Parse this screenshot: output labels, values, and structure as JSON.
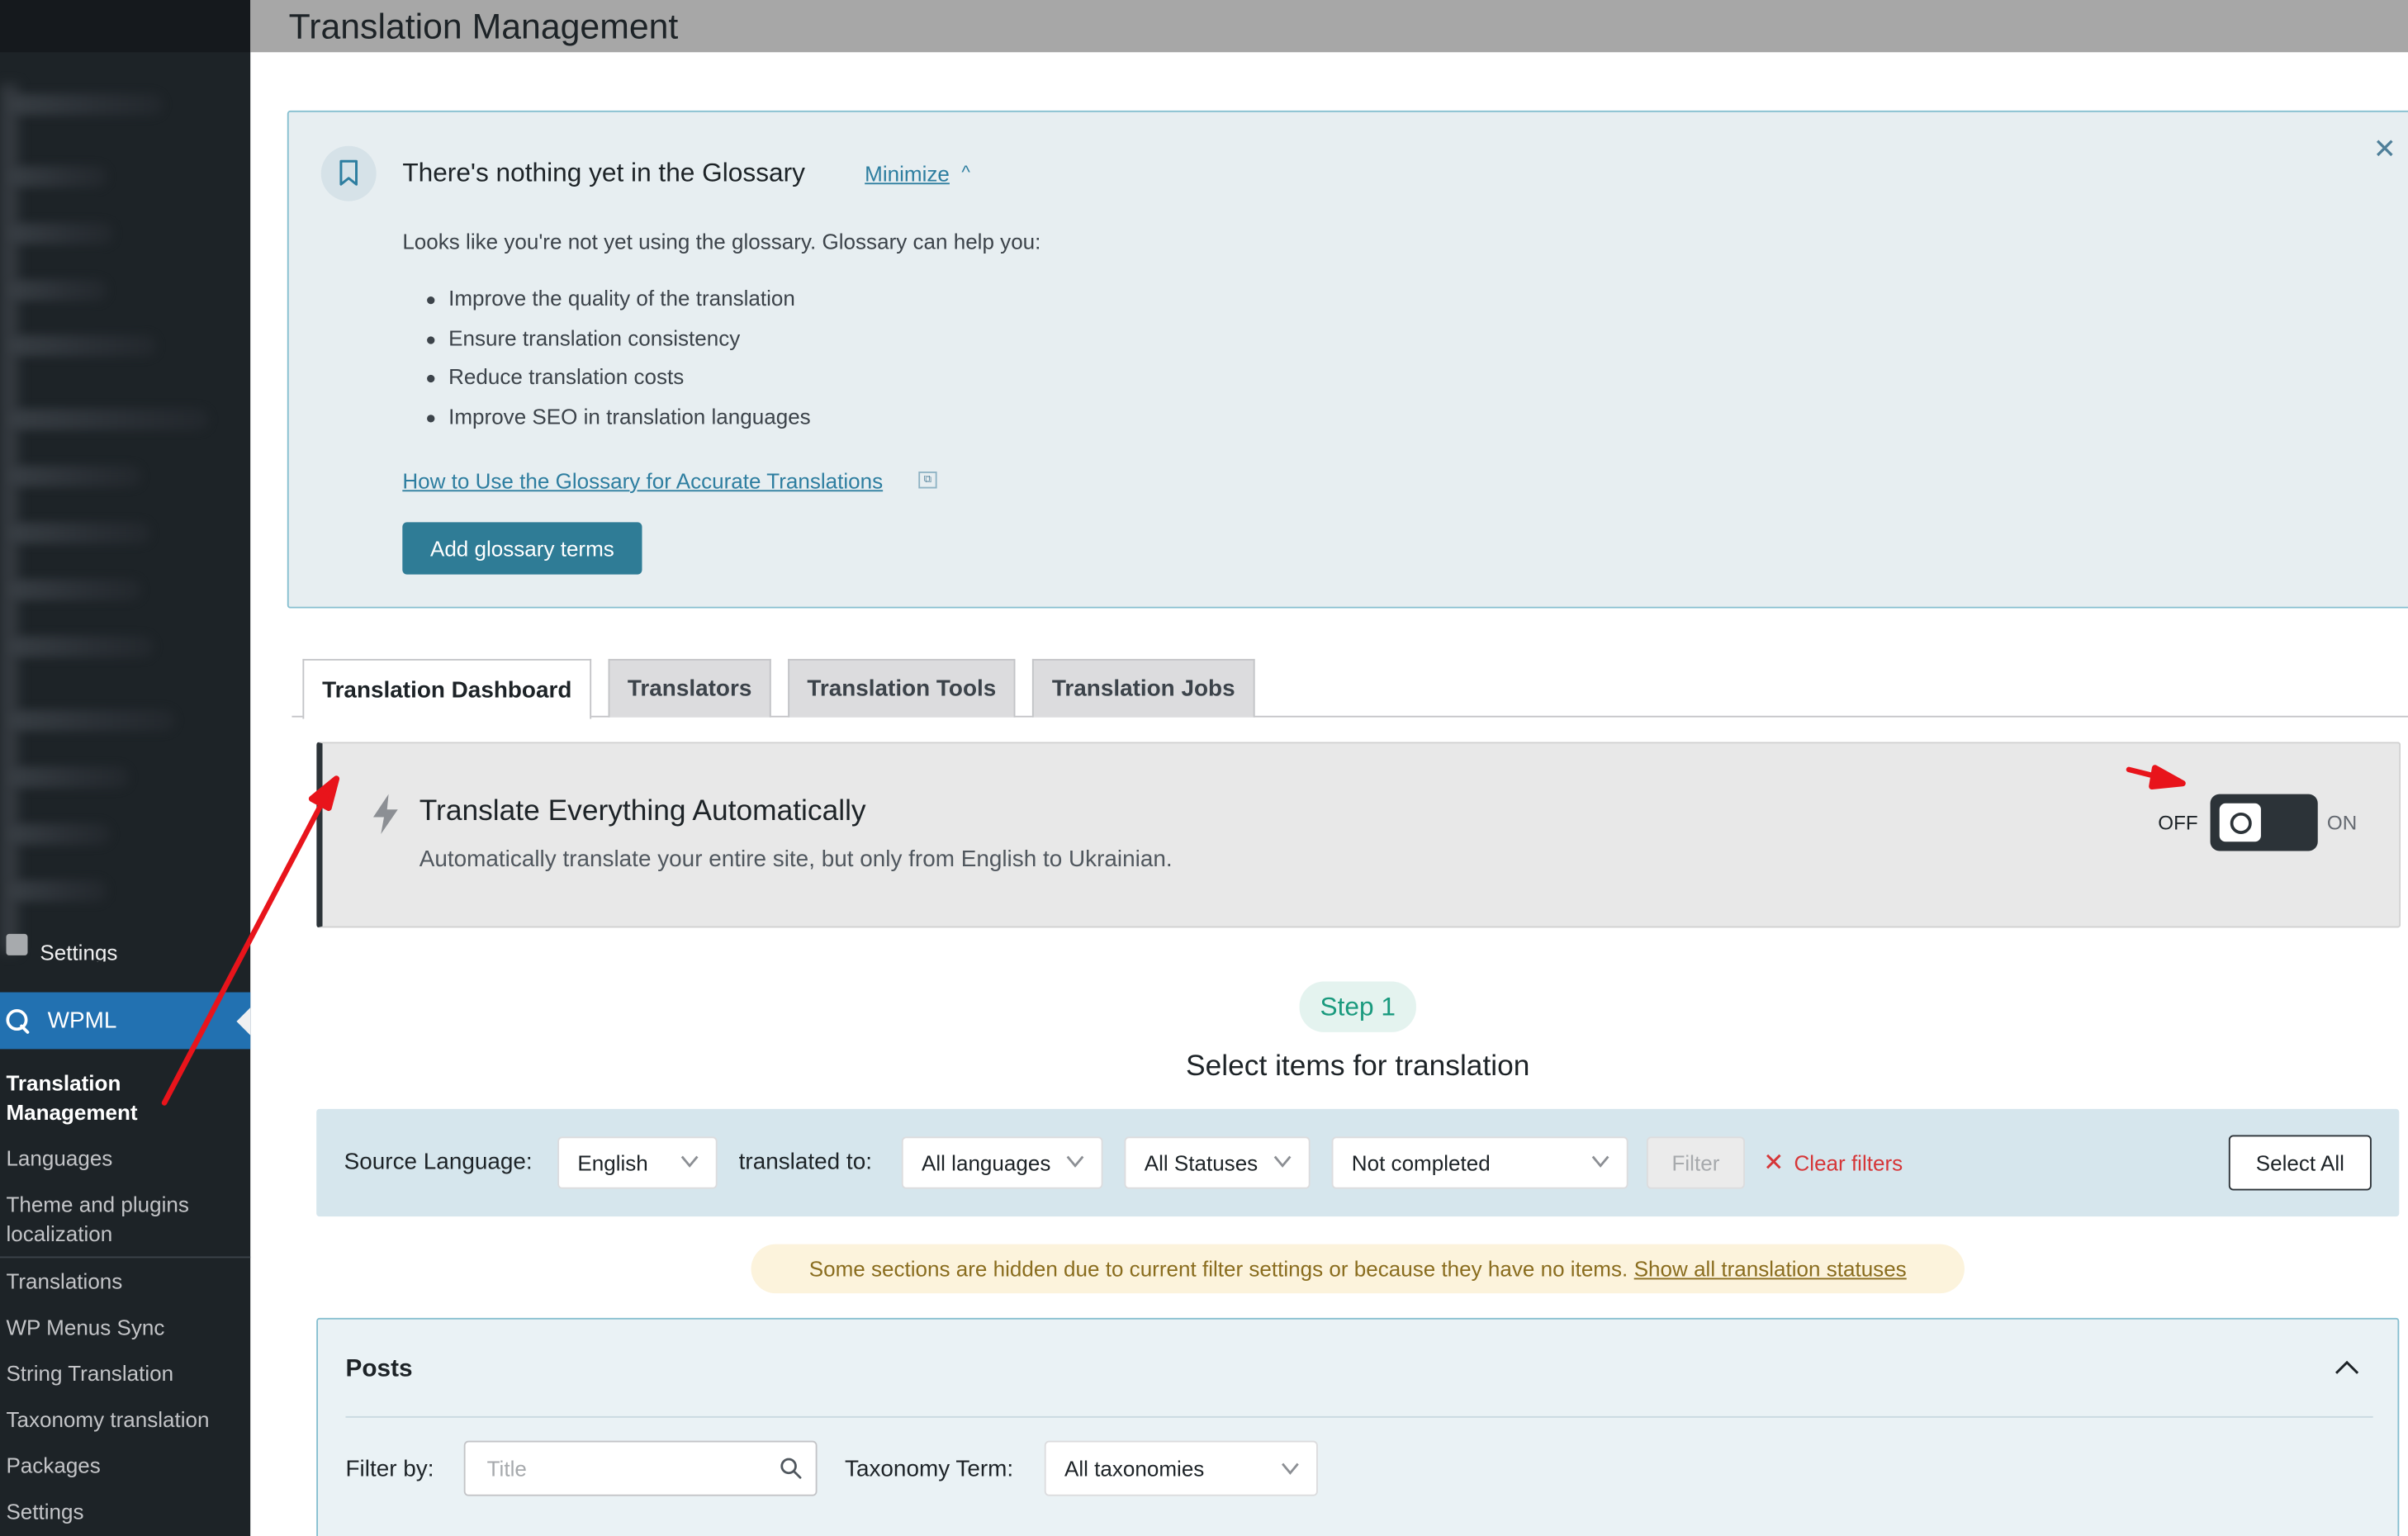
{
  "page": {
    "title": "Translation Management"
  },
  "sidebar": {
    "partial_item_label": "Settings",
    "active_menu": "WPML",
    "submenu": [
      {
        "label": "Translation Management",
        "current": true
      },
      {
        "label": "Languages"
      },
      {
        "label": "Theme and plugins localization"
      },
      {
        "label": "Translations"
      },
      {
        "label": "WP Menus Sync"
      },
      {
        "label": "String Translation"
      },
      {
        "label": "Taxonomy translation"
      },
      {
        "label": "Packages"
      },
      {
        "label": "Settings"
      }
    ]
  },
  "glossary": {
    "title": "There's nothing yet in the Glossary",
    "minimize_label": "Minimize",
    "description": "Looks like you're not yet using the glossary. Glossary can help you:",
    "benefits": [
      "Improve the quality of the translation",
      "Ensure translation consistency",
      "Reduce translation costs",
      "Improve SEO in translation languages"
    ],
    "help_link": "How to Use the Glossary for Accurate Translations",
    "add_button": "Add glossary terms"
  },
  "tabs": [
    {
      "label": "Translation Dashboard",
      "active": true
    },
    {
      "label": "Translators"
    },
    {
      "label": "Translation Tools"
    },
    {
      "label": "Translation Jobs"
    }
  ],
  "translate_everything": {
    "title": "Translate Everything Automatically",
    "subtitle": "Automatically translate your entire site, but only from English to Ukrainian.",
    "toggle_off_label": "OFF",
    "toggle_on_label": "ON",
    "toggle_state": "off"
  },
  "step": {
    "pill": "Step 1",
    "title": "Select items for translation"
  },
  "filters": {
    "source_language_label": "Source Language:",
    "source_language_value": "English",
    "translated_to_label": "translated to:",
    "target_language_value": "All languages",
    "status_value": "All Statuses",
    "completion_value": "Not completed",
    "filter_button": "Filter",
    "clear_filters": "Clear filters",
    "select_all": "Select All"
  },
  "notice": {
    "text": "Some sections are hidden due to current filter settings or because they have no items.",
    "link": "Show all translation statuses"
  },
  "posts_section": {
    "title": "Posts",
    "filter_by_label": "Filter by:",
    "title_placeholder": "Title",
    "taxonomy_label": "Taxonomy Term:",
    "taxonomy_value": "All taxonomies"
  },
  "colors": {
    "wpml_accent": "#2271b1",
    "sidebar_bg": "#1d2327",
    "glossary_button": "#2f7c96",
    "clear_filters": "#d63638",
    "step_pill_text": "#1a9a7e",
    "annotation_arrow": "#e8141b"
  }
}
